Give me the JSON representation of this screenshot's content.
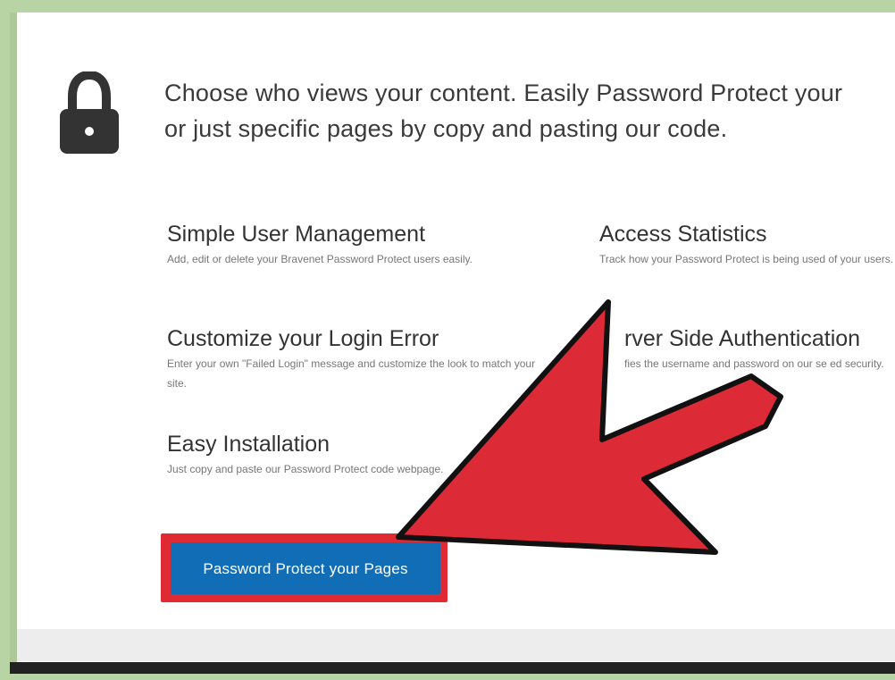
{
  "headline": {
    "line1": "Choose who views your content. Easily Password Protect your",
    "line2": "or just specific pages by copy and pasting our code."
  },
  "features": [
    {
      "title": "Simple User Management",
      "desc": "Add, edit or delete your Bravenet Password Protect users easily."
    },
    {
      "title": "Access Statistics",
      "desc": "Track how your Password Protect is being used of your users."
    },
    {
      "title": "Customize your Login Error",
      "desc": "Enter your own \"Failed Login\" message and customize the look to match your site."
    },
    {
      "title": "rver Side Authentication",
      "desc": "fies the username and password on our se ed security."
    },
    {
      "title": "Easy Installation",
      "desc": "Just copy and paste our Password Protect code webpage."
    }
  ],
  "cta": {
    "label": "Password Protect your Pages"
  },
  "colors": {
    "button": "#116eb6",
    "highlight": "#e02a33",
    "arrow": "#dc2b36"
  },
  "icons": {
    "lock": "lock-icon",
    "pointer": "red-arrow-pointer"
  }
}
